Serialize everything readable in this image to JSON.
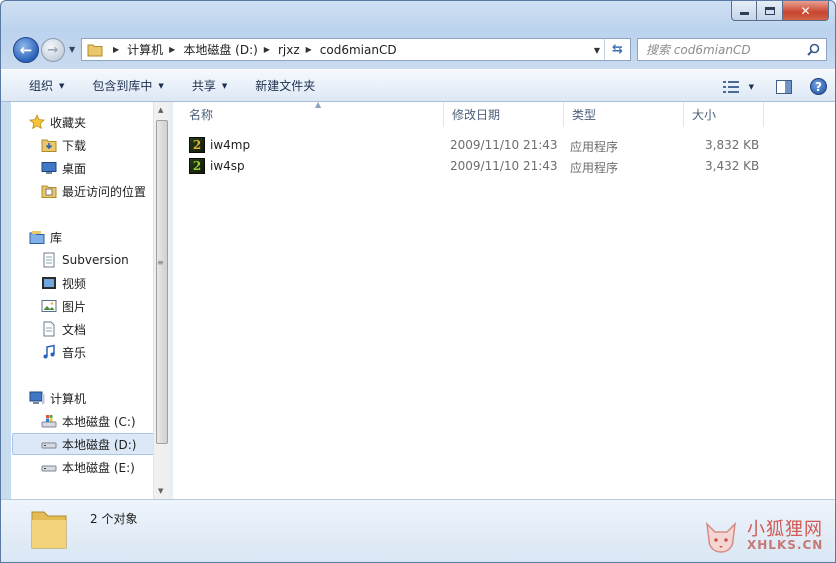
{
  "window": {
    "caption": {
      "minimize": "min",
      "maximize": "max",
      "close": "x"
    }
  },
  "address": {
    "crumbs": [
      "计算机",
      "本地磁盘 (D:)",
      "rjxz",
      "cod6mianCD"
    ]
  },
  "search": {
    "placeholder": "搜索 cod6mianCD"
  },
  "toolbar": {
    "organize": "组织",
    "include_in_library": "包含到库中",
    "share": "共享",
    "new_folder": "新建文件夹"
  },
  "nav": {
    "favorites": "收藏夹",
    "downloads": "下载",
    "desktop": "桌面",
    "recent": "最近访问的位置",
    "libraries": "库",
    "subversion": "Subversion",
    "videos": "视频",
    "pictures": "图片",
    "documents": "文档",
    "music": "音乐",
    "computer": "计算机",
    "drive_c": "本地磁盘 (C:)",
    "drive_d": "本地磁盘 (D:)",
    "drive_e": "本地磁盘 (E:)"
  },
  "columns": {
    "name": "名称",
    "modified": "修改日期",
    "type": "类型",
    "size": "大小"
  },
  "files": [
    {
      "name": "iw4mp",
      "modified": "2009/11/10 21:43",
      "type": "应用程序",
      "size": "3,832 KB"
    },
    {
      "name": "iw4sp",
      "modified": "2009/11/10 21:43",
      "type": "应用程序",
      "size": "3,432 KB"
    }
  ],
  "status": {
    "count": "2 个对象"
  },
  "watermark": {
    "cn": "小狐狸网",
    "en": "XHLKS.CN"
  },
  "colors": {
    "selection": "#dce8f6",
    "accent": "#2a62b8",
    "close": "#c7452e"
  }
}
